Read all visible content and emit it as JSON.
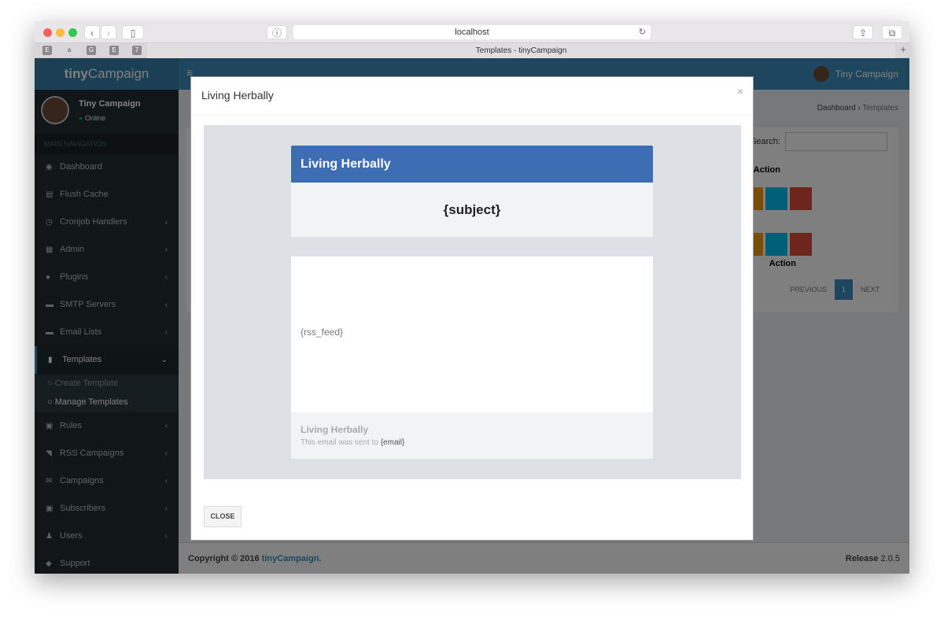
{
  "browser": {
    "url": "localhost",
    "tab_title": "Templates - tinyCampaign",
    "favorites": [
      "E",
      "a",
      "G",
      "E",
      "7"
    ]
  },
  "app": {
    "logo_bold": "tiny",
    "logo_rest": "Campaign",
    "user_name": "Tiny Campaign",
    "user_status": "Online",
    "nav_header": "MAIN NAVIGATION"
  },
  "sidebar": {
    "items": [
      {
        "label": "Dashboard",
        "icon": "dashboard-icon"
      },
      {
        "label": "Flush Cache",
        "icon": "cache-icon"
      },
      {
        "label": "Cronjob Handlers",
        "icon": "clock-icon",
        "chevron": true
      },
      {
        "label": "Admin",
        "icon": "grid-icon",
        "chevron": true
      },
      {
        "label": "Plugins",
        "icon": "plug-icon",
        "chevron": true
      },
      {
        "label": "SMTP Servers",
        "icon": "server-icon",
        "chevron": true
      },
      {
        "label": "Email Lists",
        "icon": "list-icon",
        "chevron": true
      },
      {
        "label": "Templates",
        "icon": "file-icon",
        "chevron": true
      }
    ],
    "sub_items": [
      "Create Template",
      "Manage Templates"
    ],
    "items2": [
      {
        "label": "Rules",
        "icon": "rules-icon"
      },
      {
        "label": "RSS Campaigns",
        "icon": "rss-icon"
      },
      {
        "label": "Campaigns",
        "icon": "envelope-icon"
      },
      {
        "label": "Subscribers",
        "icon": "contact-icon"
      },
      {
        "label": "Users",
        "icon": "users-icon"
      },
      {
        "label": "Support",
        "icon": "tag-icon"
      }
    ]
  },
  "content": {
    "breadcrumb": [
      "Dashboard",
      "Templates"
    ],
    "search_label": "Search:",
    "action_header": "Action",
    "pagination": {
      "previous": "PREVIOUS",
      "page": "1",
      "next": "NEXT"
    }
  },
  "footer": {
    "copyright": "Copyright © 2016 ",
    "brand": "tinyCampaign.",
    "release_label": "Release ",
    "release": "2.0.5"
  },
  "modal": {
    "title": "Living Herbally",
    "close_x": "×",
    "email": {
      "header": "Living Herbally",
      "subject": "{subject}",
      "body": "{rss_feed}",
      "footer_title": "Living Herbally",
      "footer_text": "This email was sent to ",
      "footer_email": "{email}"
    },
    "close_button": "CLOSE"
  }
}
